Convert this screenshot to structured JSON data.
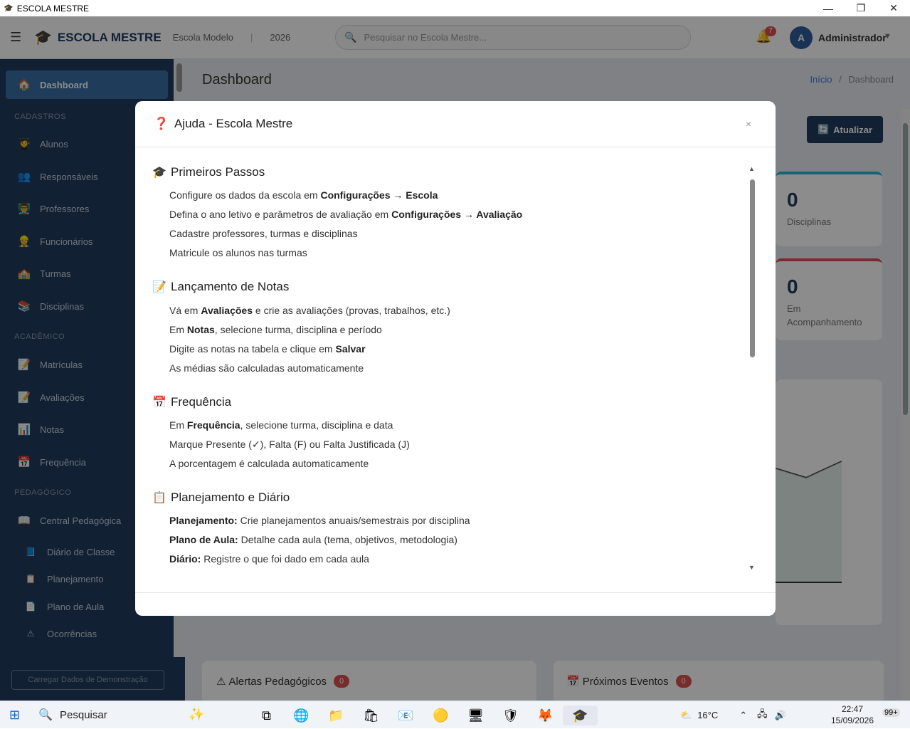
{
  "window": {
    "title": "ESCOLA MESTRE"
  },
  "topbar": {
    "brand": "ESCOLA MESTRE",
    "school": "Escola Modelo",
    "separator": "|",
    "year": "2026",
    "search_placeholder": "Pesquisar no Escola Mestre...",
    "notification_count": "7",
    "avatar_letter": "A",
    "user": "Administrador"
  },
  "sidebar": {
    "dashboard": "Dashboard",
    "head_cadastros": "CADASTROS",
    "alunos": "Alunos",
    "responsaveis": "Responsáveis",
    "professores": "Professores",
    "funcionarios": "Funcionários",
    "turmas": "Turmas",
    "disciplinas": "Disciplinas",
    "head_academico": "ACADÊMICO",
    "matriculas": "Matrículas",
    "avaliacoes": "Avaliações",
    "notas": "Notas",
    "frequencia": "Frequência",
    "head_pedagogico": "PEDAGÓGICO",
    "central": "Central Pedagógica",
    "diario": "Diário de Classe",
    "planejamento": "Planejamento",
    "plano_aula": "Plano de Aula",
    "ocorrencias": "Ocorrências",
    "demo_button": "Carregar Dados de Demonstração"
  },
  "main": {
    "title": "Dashboard",
    "crumb_home": "Início",
    "crumb_sep": "/",
    "crumb_current": "Dashboard",
    "refresh": "Atualizar",
    "card_disciplinas_num": "0",
    "card_disciplinas_label": "Disciplinas",
    "card_acomp_num": "0",
    "card_acomp_label": "Em Acompanhamento",
    "alertas": "Alertas Pedagógicos",
    "alertas_count": "0",
    "eventos": "Próximos Eventos",
    "eventos_count": "0"
  },
  "modal": {
    "title": "Ajuda - Escola Mestre",
    "close": "×",
    "s1_title": "Primeiros Passos",
    "s1_l1_a": "Configure os dados da escola em ",
    "s1_l1_b": "Configurações → Escola",
    "s1_l2_a": "Defina o ano letivo e parâmetros de avaliação em ",
    "s1_l2_b": "Configurações → Avaliação",
    "s1_l3": "Cadastre professores, turmas e disciplinas",
    "s1_l4": "Matricule os alunos nas turmas",
    "s2_title": "Lançamento de Notas",
    "s2_l1_a": "Vá em ",
    "s2_l1_b": "Avaliações",
    "s2_l1_c": " e crie as avaliações (provas, trabalhos, etc.)",
    "s2_l2_a": "Em ",
    "s2_l2_b": "Notas",
    "s2_l2_c": ", selecione turma, disciplina e período",
    "s2_l3_a": "Digite as notas na tabela e clique em ",
    "s2_l3_b": "Salvar",
    "s2_l4": "As médias são calculadas automaticamente",
    "s3_title": "Frequência",
    "s3_l1_a": "Em ",
    "s3_l1_b": "Frequência",
    "s3_l1_c": ", selecione turma, disciplina e data",
    "s3_l2": "Marque Presente (✓), Falta (F) ou Falta Justificada (J)",
    "s3_l3": "A porcentagem é calculada automaticamente",
    "s4_title": "Planejamento e Diário",
    "s4_l1_a": "Planejamento:",
    "s4_l1_b": " Crie planejamentos anuais/semestrais por disciplina",
    "s4_l2_a": "Plano de Aula:",
    "s4_l2_b": " Detalhe cada aula (tema, objetivos, metodologia)",
    "s4_l3_a": "Diário:",
    "s4_l3_b": " Registre o que foi dado em cada aula"
  },
  "taskbar": {
    "search": "Pesquisar",
    "weather": "16°C",
    "time": "22:47",
    "date": "15/09/2026",
    "notifications": "99+"
  }
}
